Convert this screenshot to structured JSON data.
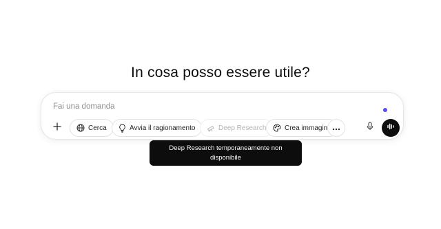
{
  "main": {
    "heading": "In cosa posso essere utile?"
  },
  "composer": {
    "placeholder": "Fai una domanda",
    "status_dot_color": "#5b4ef0",
    "add_icon": "plus-icon",
    "tools": [
      {
        "label": "Cerca",
        "icon": "globe-icon",
        "disabled": false
      },
      {
        "label": "Avvia il ragionamento",
        "icon": "lightbulb-icon",
        "disabled": false
      },
      {
        "label": "Deep Research",
        "icon": "telescope-icon",
        "disabled": true
      },
      {
        "label": "Crea immagine",
        "icon": "palette-icon",
        "disabled": false
      }
    ],
    "more_icon": "more-dots-icon",
    "mic_icon": "microphone-icon",
    "voice_icon": "voice-mode-icon",
    "voice_button_color": "#0d0d0d"
  },
  "tooltip": {
    "text": "Deep Research temporaneamente non disponibile"
  }
}
